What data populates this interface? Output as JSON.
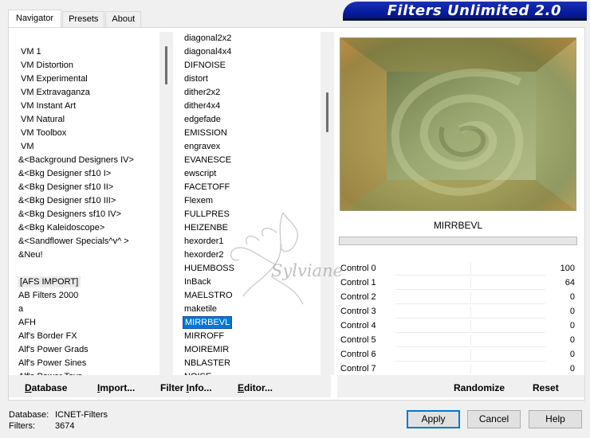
{
  "tabs": [
    {
      "label": "Navigator",
      "active": true
    },
    {
      "label": "Presets",
      "active": false
    },
    {
      "label": "About",
      "active": false
    }
  ],
  "banner": {
    "title": "Filters Unlimited 2.0"
  },
  "categories": [
    {
      "label": "VM 1"
    },
    {
      "label": "VM Distortion"
    },
    {
      "label": "VM Experimental"
    },
    {
      "label": "VM Extravaganza"
    },
    {
      "label": "VM Instant Art"
    },
    {
      "label": "VM Natural"
    },
    {
      "label": "VM Toolbox"
    },
    {
      "label": "VM"
    },
    {
      "label": "&<Background Designers IV>"
    },
    {
      "label": "&<Bkg Designer sf10 I>"
    },
    {
      "label": "&<Bkg Designer sf10 II>"
    },
    {
      "label": "&<Bkg Designer sf10 III>"
    },
    {
      "label": "&<Bkg Designers sf10 IV>"
    },
    {
      "label": "&<Bkg Kaleidoscope>"
    },
    {
      "label": "&<Sandflower Specials^v^ >"
    },
    {
      "label": "&Neu!"
    },
    {
      "label": ""
    },
    {
      "label": "[AFS IMPORT]"
    },
    {
      "label": "AB Filters 2000"
    },
    {
      "label": "a"
    },
    {
      "label": "AFH"
    },
    {
      "label": "Alf's Border FX"
    },
    {
      "label": "Alf's Power Grads"
    },
    {
      "label": "Alf's Power Sines"
    },
    {
      "label": "Alf's Power Toys"
    }
  ],
  "filters": [
    {
      "label": "diagonal2x2"
    },
    {
      "label": "diagonal4x4"
    },
    {
      "label": "DIFNOISE"
    },
    {
      "label": "distort"
    },
    {
      "label": "dither2x2"
    },
    {
      "label": "dither4x4"
    },
    {
      "label": "edgefade"
    },
    {
      "label": "EMISSION"
    },
    {
      "label": "engravex"
    },
    {
      "label": "EVANESCE"
    },
    {
      "label": "ewscript"
    },
    {
      "label": "FACETOFF"
    },
    {
      "label": "Flexem"
    },
    {
      "label": "FULLPRES"
    },
    {
      "label": "HEIZENBE"
    },
    {
      "label": "hexorder1"
    },
    {
      "label": "hexorder2"
    },
    {
      "label": "HUEMBOSS"
    },
    {
      "label": "InBack"
    },
    {
      "label": "MAELSTRO"
    },
    {
      "label": "maketile"
    },
    {
      "label": "MIRRBEVL"
    },
    {
      "label": "MIRROFF"
    },
    {
      "label": "MOIREMIR"
    },
    {
      "label": "NBLASTER"
    },
    {
      "label": "NOISE"
    }
  ],
  "preview": {
    "filter_name": "MIRRBEVL"
  },
  "controls": [
    {
      "label": "Control 0",
      "value": "100",
      "level": 0.39
    },
    {
      "label": "Control 1",
      "value": "64",
      "level": 0.25
    },
    {
      "label": "Control 2",
      "value": "0",
      "level": 0
    },
    {
      "label": "Control 3",
      "value": "0",
      "level": 0
    },
    {
      "label": "Control 4",
      "value": "0",
      "level": 0
    },
    {
      "label": "Control 5",
      "value": "0",
      "level": 0
    },
    {
      "label": "Control 6",
      "value": "0",
      "level": 0
    },
    {
      "label": "Control 7",
      "value": "0",
      "level": 0
    }
  ],
  "toolbar": {
    "database": {
      "u": "D",
      "rest": "atabase"
    },
    "import": {
      "u": "I",
      "rest": "mport..."
    },
    "filter_info": {
      "pre": "Filter ",
      "u": "I",
      "rest": "nfo..."
    },
    "editor": {
      "u": "E",
      "rest": "ditor..."
    },
    "randomize": "Randomize",
    "reset": "Reset"
  },
  "footer": {
    "database_label": "Database:",
    "database_value": "ICNET-Filters",
    "filters_label": "Filters:",
    "filters_value": "3674",
    "apply_label": "Apply",
    "cancel_label": "Cancel",
    "help_label": "Help"
  },
  "watermark": {
    "text": "Sylviane"
  },
  "colors": {
    "banner": "#051a9e",
    "selection": "#0078d7"
  }
}
